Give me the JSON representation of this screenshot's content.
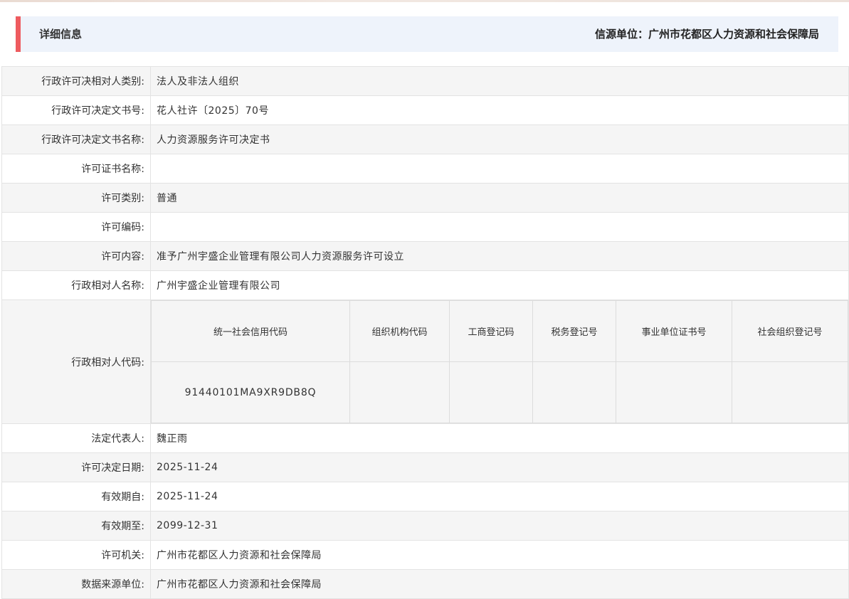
{
  "header": {
    "title": "详细信息",
    "source": "信源单位：广州市花都区人力资源和社会保障局",
    "accent_color": "#ee5b5f",
    "background_color": "#eef3fb"
  },
  "rows": [
    {
      "label": "行政许可决相对人类别:",
      "value": "法人及非法人组织"
    },
    {
      "label": "行政许可决定文书号:",
      "value": "花人社许〔2025〕70号"
    },
    {
      "label": "行政许可决定文书名称:",
      "value": "人力资源服务许可决定书"
    },
    {
      "label": "许可证书名称:",
      "value": ""
    },
    {
      "label": "许可类别:",
      "value": "普通"
    },
    {
      "label": "许可编码:",
      "value": ""
    },
    {
      "label": "许可内容:",
      "value": "准予广州宇盛企业管理有限公司人力资源服务许可设立"
    },
    {
      "label": "行政相对人名称:",
      "value": "广州宇盛企业管理有限公司"
    }
  ],
  "code_section": {
    "label": "行政相对人代码:",
    "headers": [
      "统一社会信用代码",
      "组织机构代码",
      "工商登记码",
      "税务登记号",
      "事业单位证书号",
      "社会组织登记号"
    ],
    "values": [
      "91440101MA9XR9DB8Q",
      "",
      "",
      "",
      "",
      ""
    ]
  },
  "rows_after": [
    {
      "label": "法定代表人:",
      "value": "魏正雨"
    },
    {
      "label": "许可决定日期:",
      "value": "2025-11-24"
    },
    {
      "label": "有效期自:",
      "value": "2025-11-24"
    },
    {
      "label": "有效期至:",
      "value": "2099-12-31"
    },
    {
      "label": "许可机关:",
      "value": "广州市花都区人力资源和社会保障局"
    },
    {
      "label": "数据来源单位:",
      "value": "广州市花都区人力资源和社会保障局"
    }
  ]
}
